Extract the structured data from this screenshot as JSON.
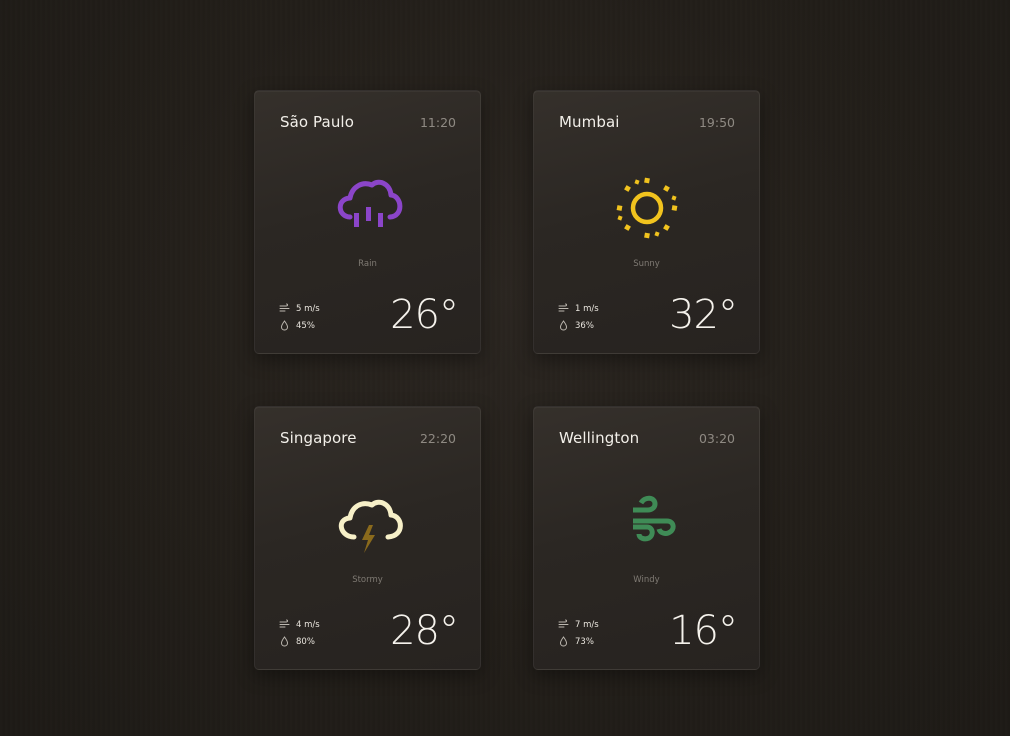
{
  "cards": [
    {
      "city": "São Paulo",
      "time": "11:20",
      "condition": "Rain",
      "icon": "rain-cloud-icon",
      "icon_color": "#8b45c9",
      "wind": "5 m/s",
      "humidity": "45%",
      "temperature": "26°"
    },
    {
      "city": "Mumbai",
      "time": "19:50",
      "condition": "Sunny",
      "icon": "sun-icon",
      "icon_color": "#f1c31e",
      "wind": "1 m/s",
      "humidity": "36%",
      "temperature": "32°"
    },
    {
      "city": "Singapore",
      "time": "22:20",
      "condition": "Stormy",
      "icon": "storm-cloud-icon",
      "icon_color": "#f7f0c8",
      "accent_color": "#8a6a1c",
      "wind": "4 m/s",
      "humidity": "80%",
      "temperature": "28°"
    },
    {
      "city": "Wellington",
      "time": "03:20",
      "condition": "Windy",
      "icon": "wind-icon",
      "icon_color": "#3f8b56",
      "wind": "7 m/s",
      "humidity": "73%",
      "temperature": "16°"
    }
  ],
  "stat_icons": {
    "wind": "wind-speed-icon",
    "humidity": "droplet-icon"
  }
}
